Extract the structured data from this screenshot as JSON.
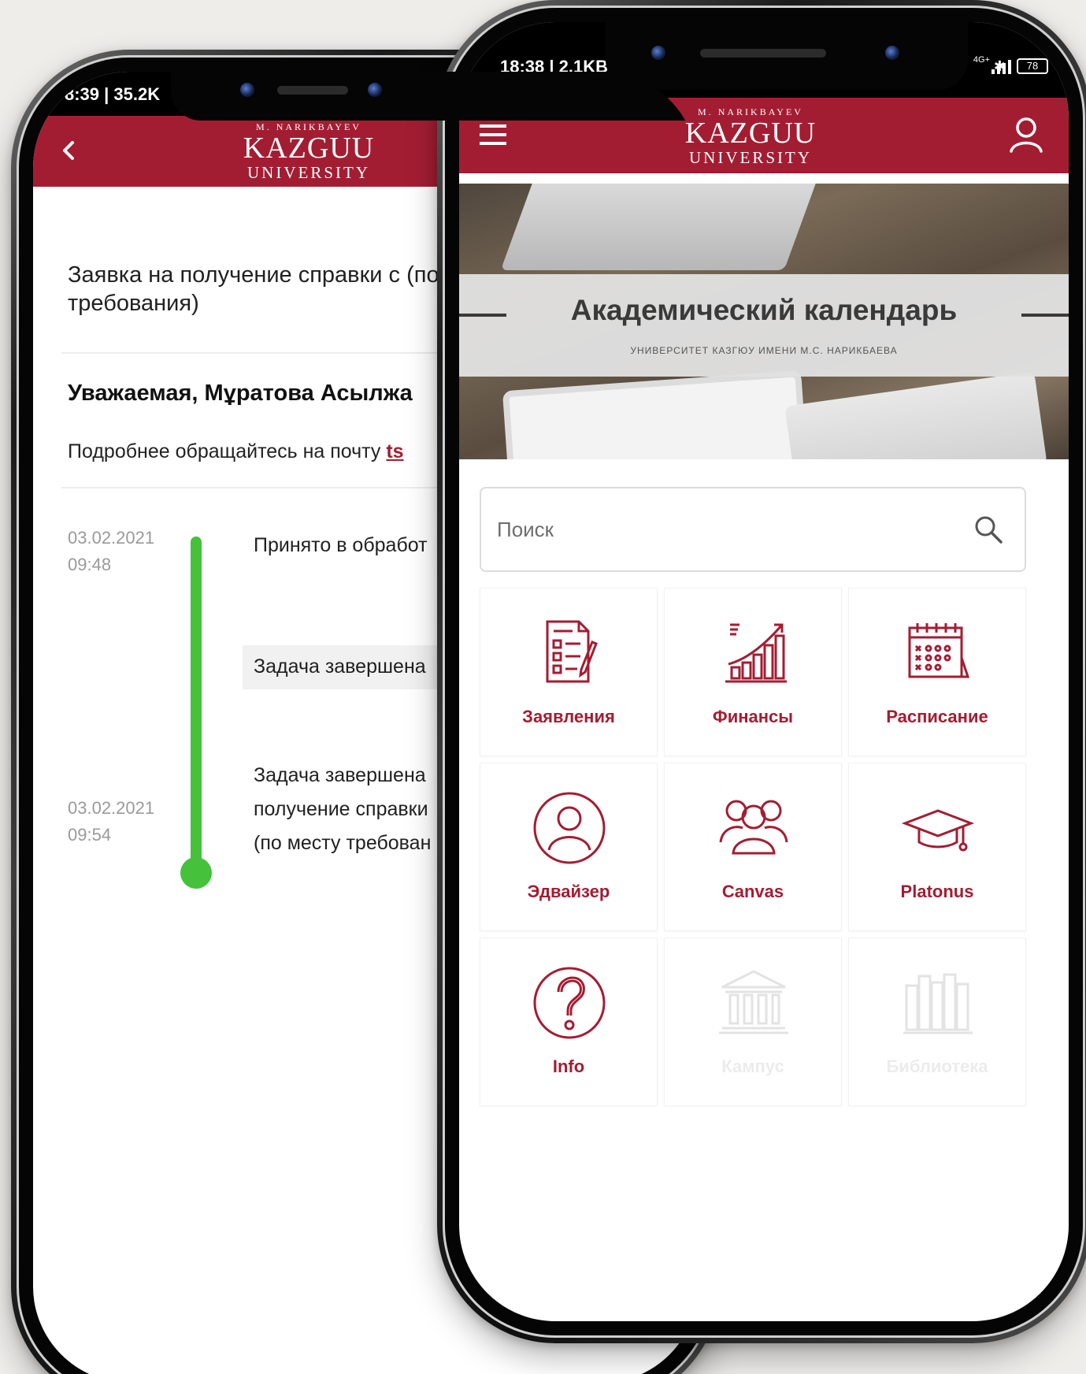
{
  "back_phone": {
    "status": {
      "time_speed": "8:39 | 35.2K"
    },
    "logo": {
      "top": "M. NARIKBAYEV",
      "mid": "KAZGUU",
      "bot": "UNIVERSITY"
    },
    "request_title": "Заявка на получение справки с (по месту требования)",
    "greeting": "Уважаемая, Мұратова Асылжа",
    "more_info_text": "Подробнее обращайтесь на почту ",
    "more_info_link": "ts",
    "timeline": [
      {
        "date": "03.02.2021",
        "time": "09:48",
        "text": "Принято в обработ"
      },
      {
        "text": "Задача завершена"
      },
      {
        "date": "03.02.2021",
        "time": "09:54",
        "text_lines": [
          "Задача завершена",
          "получение справки",
          "(по месту требован"
        ]
      }
    ]
  },
  "front_phone": {
    "status": {
      "time_speed": "18:38 | 2.1KB",
      "network": "4G+",
      "battery": "78"
    },
    "logo": {
      "top": "M. NARIKBAYEV",
      "mid": "KAZGUU",
      "bot": "UNIVERSITY"
    },
    "banner": {
      "title": "Академический календарь",
      "subtitle": "УНИВЕРСИТЕТ КАЗГЮУ ИМЕНИ М.С. НАРИКБАЕВА"
    },
    "search": {
      "placeholder": "Поиск"
    },
    "tiles": [
      {
        "label": "Заявления",
        "icon": "document-checklist-icon",
        "enabled": true
      },
      {
        "label": "Финансы",
        "icon": "growth-chart-icon",
        "enabled": true
      },
      {
        "label": "Расписание",
        "icon": "calendar-icon",
        "enabled": true
      },
      {
        "label": "Эдвайзер",
        "icon": "person-icon",
        "enabled": true
      },
      {
        "label": "Canvas",
        "icon": "group-icon",
        "enabled": true
      },
      {
        "label": "Platonus",
        "icon": "graduation-cap-icon",
        "enabled": true
      },
      {
        "label": "Info",
        "icon": "question-icon",
        "enabled": true
      },
      {
        "label": "Кампус",
        "icon": "building-icon",
        "enabled": false
      },
      {
        "label": "Библиотека",
        "icon": "books-icon",
        "enabled": false
      }
    ]
  },
  "colors": {
    "brand": "#a31d32",
    "timeline_green": "#46c13c",
    "background": "#efedea"
  }
}
